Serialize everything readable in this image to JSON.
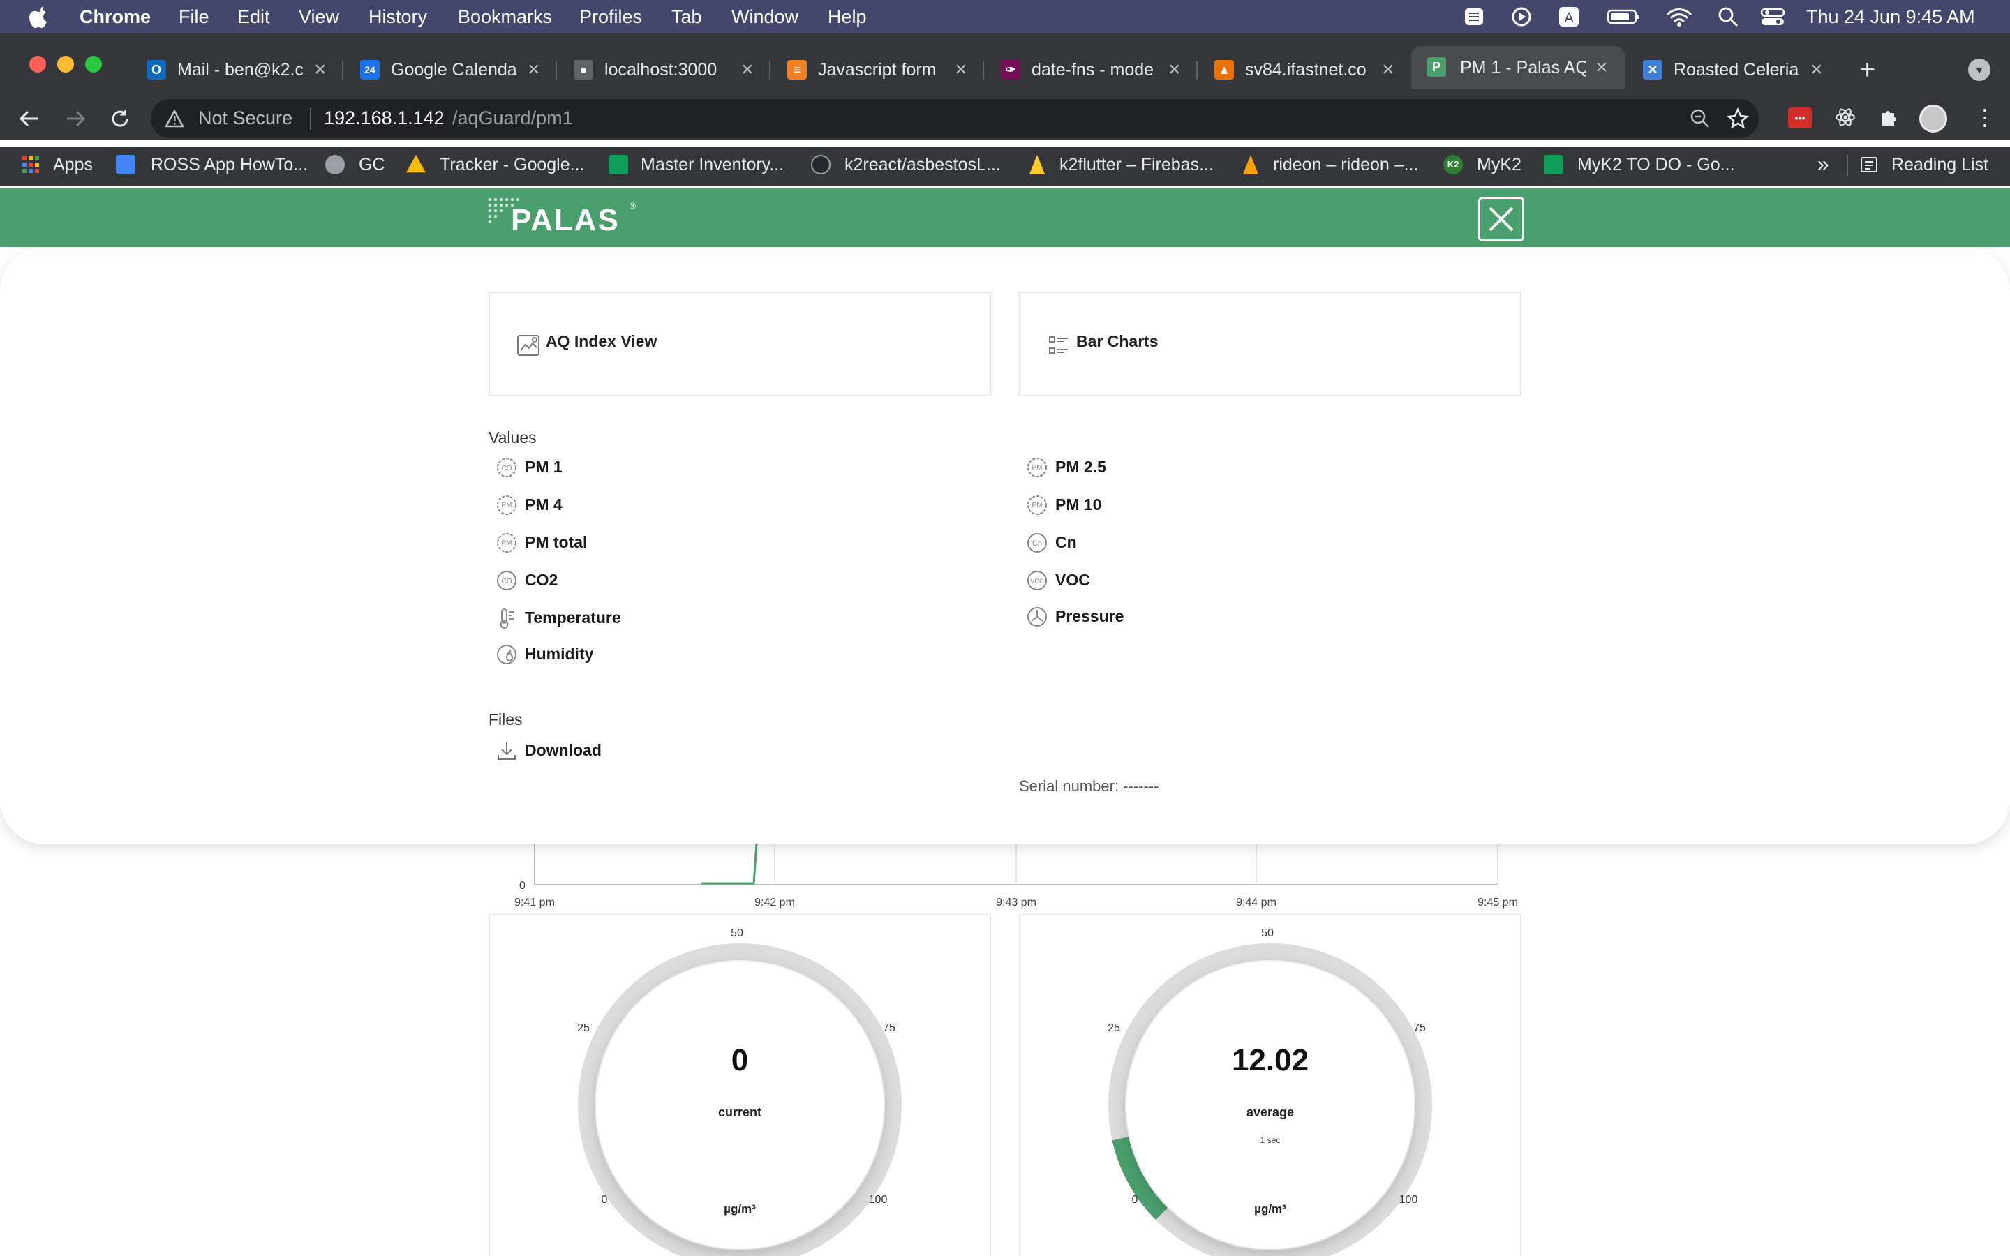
{
  "menubar": {
    "app": "Chrome",
    "items": [
      "File",
      "Edit",
      "View",
      "History",
      "Bookmarks",
      "Profiles",
      "Tab",
      "Window",
      "Help"
    ],
    "clock": "Thu 24 Jun  9:45 AM"
  },
  "tabs": [
    {
      "title": "Mail - ben@k2.c",
      "color": "#0f6cbd",
      "glyph": "O"
    },
    {
      "title": "Google Calenda",
      "color": "#1a73e8",
      "glyph": "24"
    },
    {
      "title": "localhost:3000",
      "color": "#5f6368",
      "glyph": "●"
    },
    {
      "title": "Javascript form",
      "color": "#f48024",
      "glyph": "≡"
    },
    {
      "title": "date-fns - mode",
      "color": "#770c56",
      "glyph": "✑"
    },
    {
      "title": "sv84.ifastnet.co",
      "color": "#e8710a",
      "glyph": "▲"
    },
    {
      "title": "PM 1 - Palas AQ",
      "color": "#4aa06d",
      "glyph": "P"
    },
    {
      "title": "Roasted Celeria",
      "color": "#3f7fd6",
      "glyph": "✕"
    }
  ],
  "addressbar": {
    "security": "Not Secure",
    "host": "192.168.1.142",
    "path": "/aqGuard/pm1"
  },
  "bookmarks": [
    {
      "label": "Apps",
      "color": "#ea4335"
    },
    {
      "label": "ROSS App HowTo...",
      "color": "#4285f4"
    },
    {
      "label": "GC",
      "color": "#5f6368"
    },
    {
      "label": "Tracker - Google...",
      "color": "#fbbc04"
    },
    {
      "label": "Master Inventory...",
      "color": "#0f9d58"
    },
    {
      "label": "k2react/asbestosL...",
      "color": "#24292e"
    },
    {
      "label": "k2flutter – Firebas...",
      "color": "#ffca28"
    },
    {
      "label": "rideon – rideon –...",
      "color": "#ffa000"
    },
    {
      "label": "MyK2",
      "color": "#2e7d32"
    },
    {
      "label": "MyK2 TO DO - Go...",
      "color": "#0f9d58"
    }
  ],
  "bookmarks_overflow": "»",
  "reading_list": "Reading List",
  "brand": {
    "name": "PALAS",
    "registered": "®"
  },
  "menu": {
    "cards": [
      "AQ Index View",
      "Bar Charts"
    ],
    "values_heading": "Values",
    "values_left": [
      "PM 1",
      "PM 4",
      "PM total",
      "CO2",
      "Temperature",
      "Humidity"
    ],
    "values_right": [
      "PM 2.5",
      "PM 10",
      "Cn",
      "VOC",
      "Pressure"
    ],
    "files_heading": "Files",
    "download": "Download",
    "serial": "Serial number: -------"
  },
  "chart_data": {
    "type": "line",
    "x_ticks": [
      "9:41 pm",
      "9:42 pm",
      "9:43 pm",
      "9:44 pm",
      "9:45 pm"
    ],
    "y_visible_tick": "0",
    "color": "#4aa06d"
  },
  "gauges": [
    {
      "value": "0",
      "caption": "current",
      "sub": "",
      "unit": "µg/m³",
      "ticks": [
        "50",
        "25",
        "75",
        "0",
        "100"
      ],
      "fraction": 0
    },
    {
      "value": "12.02",
      "caption": "average",
      "sub": "1 sec",
      "unit": "µg/m³",
      "ticks": [
        "50",
        "25",
        "75",
        "0",
        "100"
      ],
      "fraction": 0.1202
    }
  ]
}
